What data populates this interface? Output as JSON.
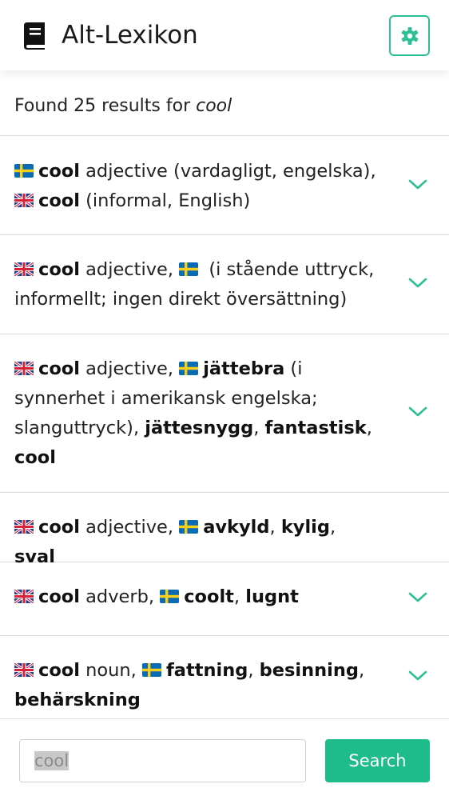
{
  "header": {
    "title": "Alt-Lexikon",
    "logo_icon": "book-icon",
    "settings_icon": "gear-icon"
  },
  "results": {
    "prefix": "Found 25 results for ",
    "query": "cool"
  },
  "entries": [
    {
      "parts": [
        {
          "type": "flag",
          "flag": "se"
        },
        {
          "type": "bold",
          "text": "cool"
        },
        {
          "type": "text",
          "text": " adjective (vardagligt, engelska), "
        },
        {
          "type": "flag",
          "flag": "gb"
        },
        {
          "type": "bold",
          "text": "cool"
        },
        {
          "type": "text",
          "text": " (informal, English)"
        }
      ],
      "expandable": true
    },
    {
      "parts": [
        {
          "type": "flag",
          "flag": "gb"
        },
        {
          "type": "bold",
          "text": "cool"
        },
        {
          "type": "text",
          "text": " adjective, "
        },
        {
          "type": "flag",
          "flag": "se"
        },
        {
          "type": "text",
          "text": " (i stående uttryck, informellt; ingen direkt översättning)"
        }
      ],
      "expandable": true
    },
    {
      "parts": [
        {
          "type": "flag",
          "flag": "gb"
        },
        {
          "type": "bold",
          "text": "cool"
        },
        {
          "type": "text",
          "text": " adjective, "
        },
        {
          "type": "flag",
          "flag": "se"
        },
        {
          "type": "bold",
          "text": "jättebra"
        },
        {
          "type": "text",
          "text": " (i synnerhet i amerikansk engelska; slanguttryck), "
        },
        {
          "type": "bold",
          "text": "jättesnygg"
        },
        {
          "type": "text",
          "text": ", "
        },
        {
          "type": "bold",
          "text": "fantastisk"
        },
        {
          "type": "text",
          "text": ", "
        },
        {
          "type": "bold",
          "text": "cool"
        }
      ],
      "expandable": true
    },
    {
      "parts": [
        {
          "type": "flag",
          "flag": "gb"
        },
        {
          "type": "bold",
          "text": "cool"
        },
        {
          "type": "text",
          "text": " adjective, "
        },
        {
          "type": "flag",
          "flag": "se"
        },
        {
          "type": "bold",
          "text": "avkyld"
        },
        {
          "type": "text",
          "text": ", "
        },
        {
          "type": "bold",
          "text": "kylig"
        },
        {
          "type": "text",
          "text": ", "
        },
        {
          "type": "bold",
          "text": "sval"
        }
      ],
      "expandable": false
    },
    {
      "parts": [
        {
          "type": "flag",
          "flag": "gb"
        },
        {
          "type": "bold",
          "text": "cool"
        },
        {
          "type": "text",
          "text": " adverb, "
        },
        {
          "type": "flag",
          "flag": "se"
        },
        {
          "type": "bold",
          "text": "coolt"
        },
        {
          "type": "text",
          "text": ", "
        },
        {
          "type": "bold",
          "text": "lugnt"
        }
      ],
      "expandable": true
    },
    {
      "parts": [
        {
          "type": "flag",
          "flag": "gb"
        },
        {
          "type": "bold",
          "text": "cool"
        },
        {
          "type": "text",
          "text": " noun, "
        },
        {
          "type": "flag",
          "flag": "se"
        },
        {
          "type": "bold",
          "text": "fattning"
        },
        {
          "type": "text",
          "text": ", "
        },
        {
          "type": "bold",
          "text": "besinning"
        },
        {
          "type": "text",
          "text": ", "
        },
        {
          "type": "bold",
          "text": "behärskning"
        }
      ],
      "expandable": true
    }
  ],
  "search": {
    "value": "cool",
    "button_label": "Search"
  },
  "colors": {
    "accent": "#1fbc8b",
    "accent_border": "#2cc096",
    "text": "#222222"
  }
}
